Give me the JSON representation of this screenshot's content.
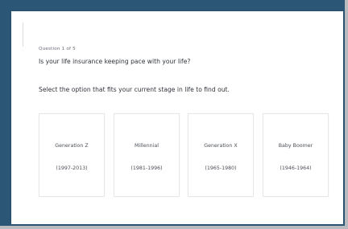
{
  "quiz": {
    "counter": "Question 1 of 5",
    "title": "Is your life insurance keeping pace with your life?",
    "instruction": "Select the option that fits your current stage in life to find out.",
    "options": [
      {
        "label": "Generation Z",
        "years": "(1997-2013)"
      },
      {
        "label": "Millennial",
        "years": "(1981-1996)"
      },
      {
        "label": "Generation X",
        "years": "(1965-1980)"
      },
      {
        "label": "Baby Boomer",
        "years": "(1946-1964)"
      }
    ]
  },
  "colors": {
    "frame": "#2b5676",
    "background": "#b9bbbe",
    "card": "#ffffff",
    "text": "#2f333a"
  }
}
